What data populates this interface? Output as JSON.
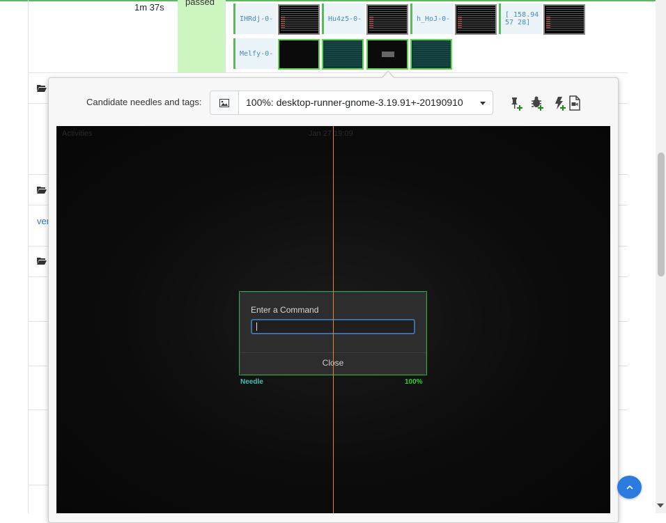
{
  "job_row": {
    "duration": "1m 37s",
    "result": "passed",
    "steps_row1": [
      {
        "label": "IHRdj-0-",
        "thumb_state": "default"
      },
      {
        "label": "Hu4z5-0-",
        "thumb_state": "default"
      },
      {
        "label": "h_HoJ-0-",
        "thumb_state": "default"
      },
      {
        "label": "[ 158.9457 28]",
        "thumb_state": "default"
      }
    ],
    "steps_row2": [
      {
        "label": "Melfy-0-",
        "thumb_states": [
          "ok",
          "ok-teal",
          "ok-selected",
          "ok-teal"
        ]
      }
    ]
  },
  "partial_link": "ver",
  "popover": {
    "candidate_label": "Candidate needles and tags:",
    "image_button_icon": "image-icon",
    "selected_needle": "100%: desktop-runner-gnome-3.19.91+-20190910",
    "tools": [
      {
        "name": "create-new-needle",
        "icon": "pin-plus-icon"
      },
      {
        "name": "report-bug",
        "icon": "bug-plus-icon"
      },
      {
        "name": "report-issue",
        "icon": "bolt-plus-icon"
      },
      {
        "name": "show-log",
        "icon": "file-video-icon"
      }
    ]
  },
  "screenshot": {
    "top_bar_left": "Activities",
    "top_bar_center": "Jan 27 19:09",
    "dialog_title": "Enter a Command",
    "dialog_input_value": "",
    "dialog_close": "Close",
    "needle_label": "Needle",
    "needle_match": "100%"
  },
  "colors": {
    "passed_bg": "#cdf5c0",
    "step_ok": "#5cb85c",
    "needle_area": "#1fae48",
    "scrollbar_button": "#2a7be0",
    "compare_line": "#e8832a"
  }
}
